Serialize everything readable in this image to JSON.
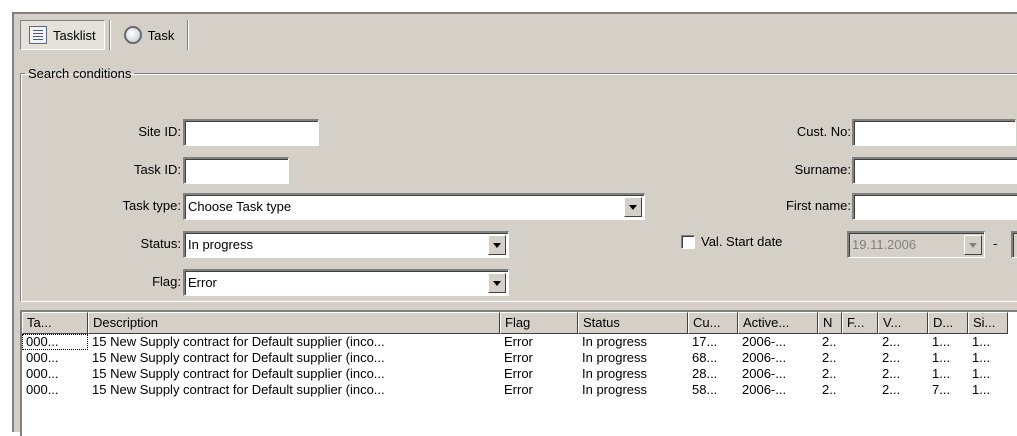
{
  "tabs": [
    {
      "label": "Tasklist",
      "icon": "list-icon",
      "active": true
    },
    {
      "label": "Task",
      "icon": "task-icon",
      "active": false
    }
  ],
  "search": {
    "legend": "Search conditions",
    "site_id": {
      "label": "Site ID:",
      "value": ""
    },
    "task_id": {
      "label": "Task ID:",
      "value": ""
    },
    "task_type": {
      "label": "Task type:",
      "value": "Choose Task type"
    },
    "status": {
      "label": "Status:",
      "value": "In progress"
    },
    "flag": {
      "label": "Flag:",
      "value": "Error"
    },
    "cust_no": {
      "label": "Cust. No:",
      "value": ""
    },
    "surname": {
      "label": "Surname:",
      "value": ""
    },
    "first_name": {
      "label": "First name:",
      "value": ""
    },
    "val_start": {
      "label": "Val. Start date",
      "checked": false,
      "date_from": "19.11.2006",
      "separator": "-"
    }
  },
  "grid": {
    "columns": [
      "Ta...",
      "Description",
      "Flag",
      "Status",
      "Cu...",
      "Active...",
      "N",
      "F...",
      "V...",
      "D...",
      "Si..."
    ],
    "rows": [
      [
        "000...",
        "15 New Supply contract for Default supplier (inco...",
        "Error",
        "In progress",
        "17...",
        "2006-...",
        "2..",
        "",
        "2...",
        "1...",
        "1..."
      ],
      [
        "000...",
        "15 New Supply contract for Default supplier (inco...",
        "Error",
        "In progress",
        "68...",
        "2006-...",
        "2..",
        "",
        "2...",
        "1...",
        "1..."
      ],
      [
        "000...",
        "15 New Supply contract for Default supplier (inco...",
        "Error",
        "In progress",
        "28...",
        "2006-...",
        "2..",
        "",
        "2...",
        "1...",
        "1..."
      ],
      [
        "000...",
        "15 New Supply contract for Default supplier (inco...",
        "Error",
        "In progress",
        "58...",
        "2006-...",
        "2..",
        "",
        "2...",
        "7...",
        "1..."
      ]
    ]
  }
}
